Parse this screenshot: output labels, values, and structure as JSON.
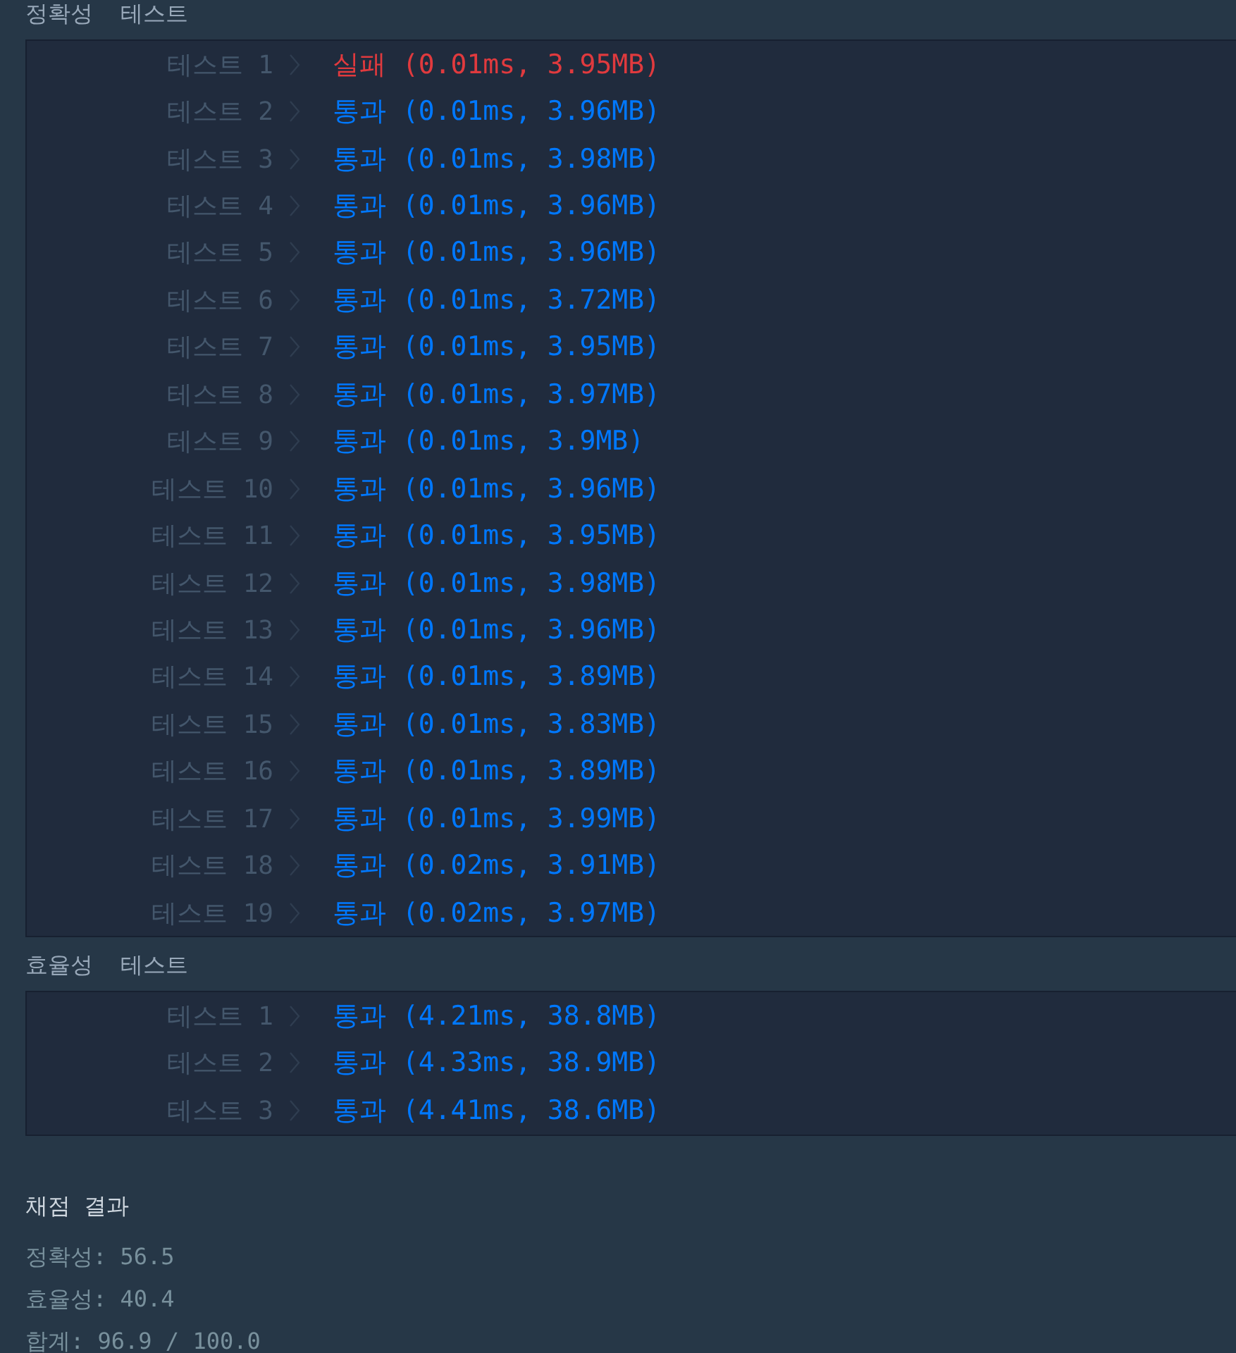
{
  "sections": [
    {
      "title": "정확성  테스트",
      "tests": [
        {
          "label": "테스트 1",
          "kind": "fail",
          "result": "실패 (0.01ms, 3.95MB)"
        },
        {
          "label": "테스트 2",
          "kind": "pass",
          "result": "통과 (0.01ms, 3.96MB)"
        },
        {
          "label": "테스트 3",
          "kind": "pass",
          "result": "통과 (0.01ms, 3.98MB)"
        },
        {
          "label": "테스트 4",
          "kind": "pass",
          "result": "통과 (0.01ms, 3.96MB)"
        },
        {
          "label": "테스트 5",
          "kind": "pass",
          "result": "통과 (0.01ms, 3.96MB)"
        },
        {
          "label": "테스트 6",
          "kind": "pass",
          "result": "통과 (0.01ms, 3.72MB)"
        },
        {
          "label": "테스트 7",
          "kind": "pass",
          "result": "통과 (0.01ms, 3.95MB)"
        },
        {
          "label": "테스트 8",
          "kind": "pass",
          "result": "통과 (0.01ms, 3.97MB)"
        },
        {
          "label": "테스트 9",
          "kind": "pass",
          "result": "통과 (0.01ms, 3.9MB)"
        },
        {
          "label": "테스트 10",
          "kind": "pass",
          "result": "통과 (0.01ms, 3.96MB)"
        },
        {
          "label": "테스트 11",
          "kind": "pass",
          "result": "통과 (0.01ms, 3.95MB)"
        },
        {
          "label": "테스트 12",
          "kind": "pass",
          "result": "통과 (0.01ms, 3.98MB)"
        },
        {
          "label": "테스트 13",
          "kind": "pass",
          "result": "통과 (0.01ms, 3.96MB)"
        },
        {
          "label": "테스트 14",
          "kind": "pass",
          "result": "통과 (0.01ms, 3.89MB)"
        },
        {
          "label": "테스트 15",
          "kind": "pass",
          "result": "통과 (0.01ms, 3.83MB)"
        },
        {
          "label": "테스트 16",
          "kind": "pass",
          "result": "통과 (0.01ms, 3.89MB)"
        },
        {
          "label": "테스트 17",
          "kind": "pass",
          "result": "통과 (0.01ms, 3.99MB)"
        },
        {
          "label": "테스트 18",
          "kind": "pass",
          "result": "통과 (0.02ms, 3.91MB)"
        },
        {
          "label": "테스트 19",
          "kind": "pass",
          "result": "통과 (0.02ms, 3.97MB)"
        }
      ]
    },
    {
      "title": "효율성  테스트",
      "tests": [
        {
          "label": "테스트 1",
          "kind": "pass",
          "result": "통과 (4.21ms, 38.8MB)"
        },
        {
          "label": "테스트 2",
          "kind": "pass",
          "result": "통과 (4.33ms, 38.9MB)"
        },
        {
          "label": "테스트 3",
          "kind": "pass",
          "result": "통과 (4.41ms, 38.6MB)"
        }
      ]
    }
  ],
  "summary": {
    "title": "채점 결과",
    "lines": [
      "정확성: 56.5",
      "효율성: 40.4",
      "합계: 96.9 / 100.0"
    ]
  }
}
